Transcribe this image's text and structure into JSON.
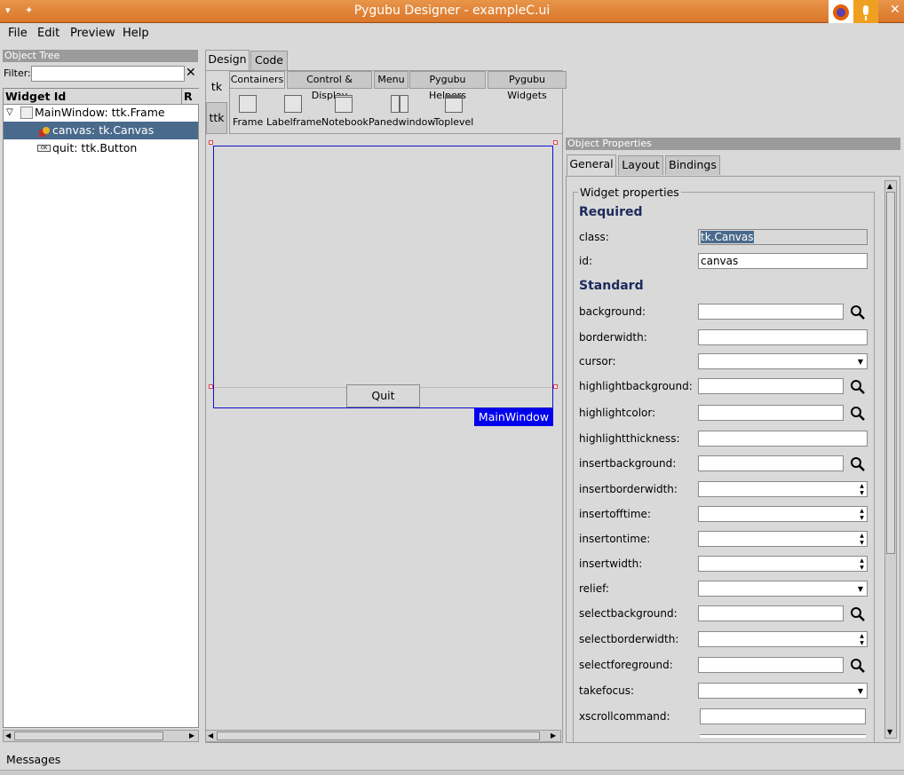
{
  "window": {
    "title": "Pygubu Designer - exampleC.ui"
  },
  "menu": {
    "file": "File",
    "edit": "Edit",
    "preview": "Preview",
    "help": "Help"
  },
  "object_tree": {
    "header": "Object Tree",
    "filter_label": "Filter:",
    "filter_value": "",
    "col_widget_id": "Widget Id",
    "col_r": "R",
    "items": [
      {
        "label": "MainWindow: ttk.Frame"
      },
      {
        "label": "canvas: tk.Canvas"
      },
      {
        "label": "quit: ttk.Button"
      }
    ]
  },
  "main_tabs": {
    "design": "Design",
    "code": "Code"
  },
  "palette": {
    "side_tabs": [
      "tk",
      "ttk"
    ],
    "tabs": [
      "Containers",
      "Control & Display",
      "Menu",
      "Pygubu Helpers",
      "Pygubu Widgets"
    ],
    "items": [
      "Frame",
      "Labelframe",
      "Notebook",
      "Panedwindow",
      "Toplevel"
    ]
  },
  "preview": {
    "button_label": "Quit",
    "frame_label": "MainWindow"
  },
  "properties": {
    "header": "Object Properties",
    "tabs": [
      "General",
      "Layout",
      "Bindings"
    ],
    "group": "Widget properties",
    "required": "Required",
    "standard": "Standard",
    "class_label": "class:",
    "class_value": "tk.Canvas",
    "id_label": "id:",
    "id_value": "canvas",
    "standard_props": [
      {
        "label": "background:"
      },
      {
        "label": "borderwidth:"
      },
      {
        "label": "cursor:"
      },
      {
        "label": "highlightbackground:"
      },
      {
        "label": "highlightcolor:"
      },
      {
        "label": "highlightthickness:"
      },
      {
        "label": "insertbackground:"
      },
      {
        "label": "insertborderwidth:"
      },
      {
        "label": "insertofftime:"
      },
      {
        "label": "insertontime:"
      },
      {
        "label": "insertwidth:"
      },
      {
        "label": "relief:"
      },
      {
        "label": "selectbackground:"
      },
      {
        "label": "selectborderwidth:"
      },
      {
        "label": "selectforeground:"
      },
      {
        "label": "takefocus:"
      },
      {
        "label": "xscrollcommand:"
      }
    ]
  },
  "status": {
    "messages": "Messages"
  },
  "colors": {
    "titlebar": "#e0813a",
    "selection": "#4a6a8c",
    "frame_label_bg": "#0000ee",
    "section_text": "#1c2a5c"
  }
}
